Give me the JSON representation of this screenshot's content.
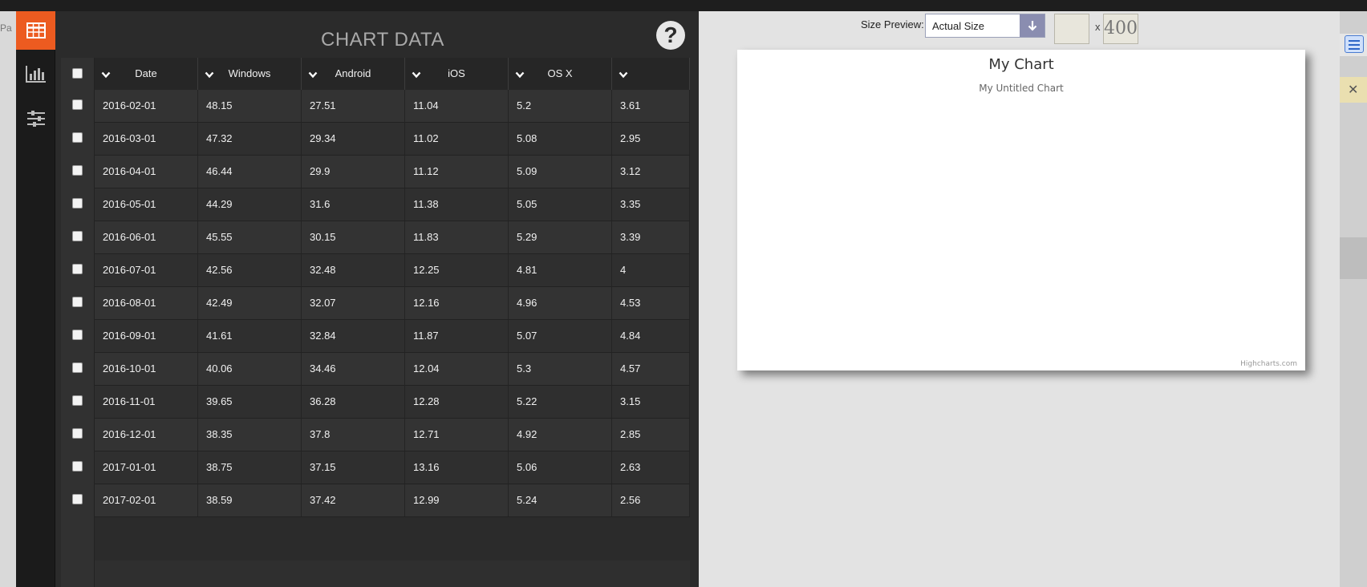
{
  "colors": {
    "accent": "#ec5b20",
    "panel": "#2b2b2b",
    "preview_bg": "#e3e3e3"
  },
  "iconbar": {
    "items": [
      {
        "icon": "table-icon",
        "active": true
      },
      {
        "icon": "bar-chart-icon",
        "active": false
      },
      {
        "icon": "sliders-icon",
        "active": false
      }
    ]
  },
  "data_panel": {
    "title": "CHART DATA",
    "help_icon": "?",
    "columns": [
      "Date",
      "Windows",
      "Android",
      "iOS",
      "OS X",
      ""
    ],
    "rows": [
      [
        "2016-02-01",
        "48.15",
        "27.51",
        "11.04",
        "5.2",
        "3.61"
      ],
      [
        "2016-03-01",
        "47.32",
        "29.34",
        "11.02",
        "5.08",
        "2.95"
      ],
      [
        "2016-04-01",
        "46.44",
        "29.9",
        "11.12",
        "5.09",
        "3.12"
      ],
      [
        "2016-05-01",
        "44.29",
        "31.6",
        "11.38",
        "5.05",
        "3.35"
      ],
      [
        "2016-06-01",
        "45.55",
        "30.15",
        "11.83",
        "5.29",
        "3.39"
      ],
      [
        "2016-07-01",
        "42.56",
        "32.48",
        "12.25",
        "4.81",
        "4"
      ],
      [
        "2016-08-01",
        "42.49",
        "32.07",
        "12.16",
        "4.96",
        "4.53"
      ],
      [
        "2016-09-01",
        "41.61",
        "32.84",
        "11.87",
        "5.07",
        "4.84"
      ],
      [
        "2016-10-01",
        "40.06",
        "34.46",
        "12.04",
        "5.3",
        "4.57"
      ],
      [
        "2016-11-01",
        "39.65",
        "36.28",
        "12.28",
        "5.22",
        "3.15"
      ],
      [
        "2016-12-01",
        "38.35",
        "37.8",
        "12.71",
        "4.92",
        "2.85"
      ],
      [
        "2017-01-01",
        "38.75",
        "37.15",
        "13.16",
        "5.06",
        "2.63"
      ],
      [
        "2017-02-01",
        "38.59",
        "37.42",
        "12.99",
        "5.24",
        "2.56"
      ]
    ]
  },
  "preview": {
    "size_label": "Size Preview:",
    "size_value": "Actual Size",
    "width_value": "",
    "times": "x",
    "height_value": "400",
    "chart": {
      "title": "My Chart",
      "subtitle": "My Untitled Chart",
      "credits": "Highcharts.com"
    }
  },
  "background": {
    "left_fragments": [
      "Pa"
    ]
  }
}
